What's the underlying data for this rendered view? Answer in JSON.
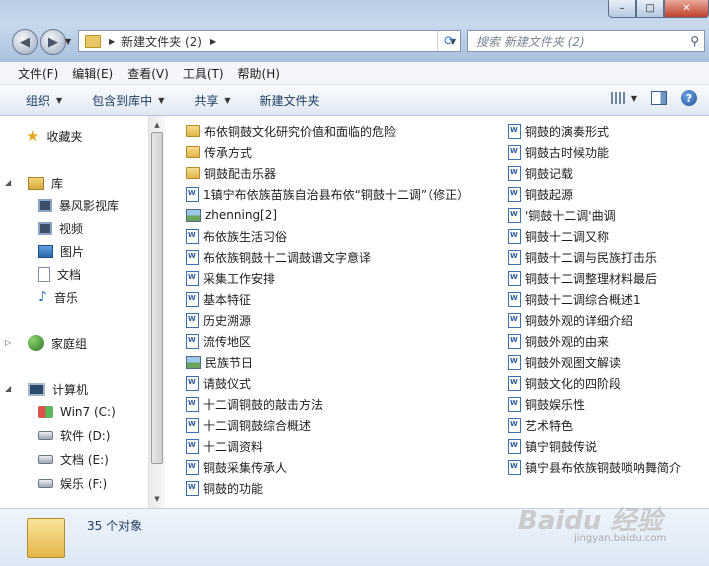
{
  "window": {
    "minimize_glyph": "–",
    "maximize_glyph": "□",
    "close_glyph": "✕"
  },
  "navigation": {
    "back_glyph": "◀",
    "forward_glyph": "▶",
    "address_path": "新建文件夹 (2)",
    "search_placeholder": "搜索 新建文件夹 (2)"
  },
  "menu": [
    "文件(F)",
    "编辑(E)",
    "查看(V)",
    "工具(T)",
    "帮助(H)"
  ],
  "toolbar": {
    "organize": "组织",
    "include_in_library": "包含到库中",
    "share": "共享",
    "new_folder": "新建文件夹"
  },
  "sidebar": {
    "favorites": "收藏夹",
    "libraries": "库",
    "library_items": [
      "暴风影视库",
      "视频",
      "图片",
      "文档",
      "音乐"
    ],
    "homegroup": "家庭组",
    "computer": "计算机",
    "drives": [
      "Win7 (C:)",
      "软件 (D:)",
      "文档 (E:)",
      "娱乐 (F:)"
    ]
  },
  "files_col1": [
    {
      "name": "布依铜鼓文化研究价值和面临的危险",
      "type": "folder"
    },
    {
      "name": "传承方式",
      "type": "folder"
    },
    {
      "name": "铜鼓配击乐器",
      "type": "folder"
    },
    {
      "name": "1镇宁布依族苗族自治县布依“铜鼓十二调”（修正）",
      "type": "word"
    },
    {
      "name": "zhenning[2]",
      "type": "image"
    },
    {
      "name": "布依族生活习俗",
      "type": "word"
    },
    {
      "name": "布依族铜鼓十二调鼓谱文字意译",
      "type": "word"
    },
    {
      "name": "采集工作安排",
      "type": "word"
    },
    {
      "name": "基本特征",
      "type": "word"
    },
    {
      "name": "历史溯源",
      "type": "word"
    },
    {
      "name": "流传地区",
      "type": "word"
    },
    {
      "name": "民族节日",
      "type": "image"
    },
    {
      "name": "请鼓仪式",
      "type": "word"
    },
    {
      "name": "十二调铜鼓的敲击方法",
      "type": "word"
    },
    {
      "name": "十二调铜鼓综合概述",
      "type": "word"
    },
    {
      "name": "十二调资料",
      "type": "word"
    },
    {
      "name": "铜鼓采集传承人",
      "type": "word"
    },
    {
      "name": "铜鼓的功能",
      "type": "word"
    }
  ],
  "files_col2": [
    {
      "name": "铜鼓的演奏形式",
      "type": "word"
    },
    {
      "name": "铜鼓古时候功能",
      "type": "word"
    },
    {
      "name": "铜鼓记载",
      "type": "word"
    },
    {
      "name": "铜鼓起源",
      "type": "word"
    },
    {
      "name": "'铜鼓十二调'曲调",
      "type": "word"
    },
    {
      "name": "铜鼓十二调又称",
      "type": "word"
    },
    {
      "name": "铜鼓十二调与民族打击乐",
      "type": "word"
    },
    {
      "name": "铜鼓十二调整理材料最后",
      "type": "word"
    },
    {
      "name": "铜鼓十二调综合概述1",
      "type": "word"
    },
    {
      "name": "铜鼓外观的详细介绍",
      "type": "word"
    },
    {
      "name": "铜鼓外观的由来",
      "type": "word"
    },
    {
      "name": "铜鼓外观图文解读",
      "type": "word"
    },
    {
      "name": "铜鼓文化的四阶段",
      "type": "word"
    },
    {
      "name": "铜鼓娱乐性",
      "type": "word"
    },
    {
      "name": "艺术特色",
      "type": "word"
    },
    {
      "name": "镇宁铜鼓传说",
      "type": "word"
    },
    {
      "name": "镇宁县布依族铜鼓唢呐舞简介",
      "type": "word"
    }
  ],
  "status": {
    "item_count": "35 个对象"
  },
  "watermark": {
    "brand": "Baidu 经验",
    "url": "jingyan.baidu.com"
  }
}
